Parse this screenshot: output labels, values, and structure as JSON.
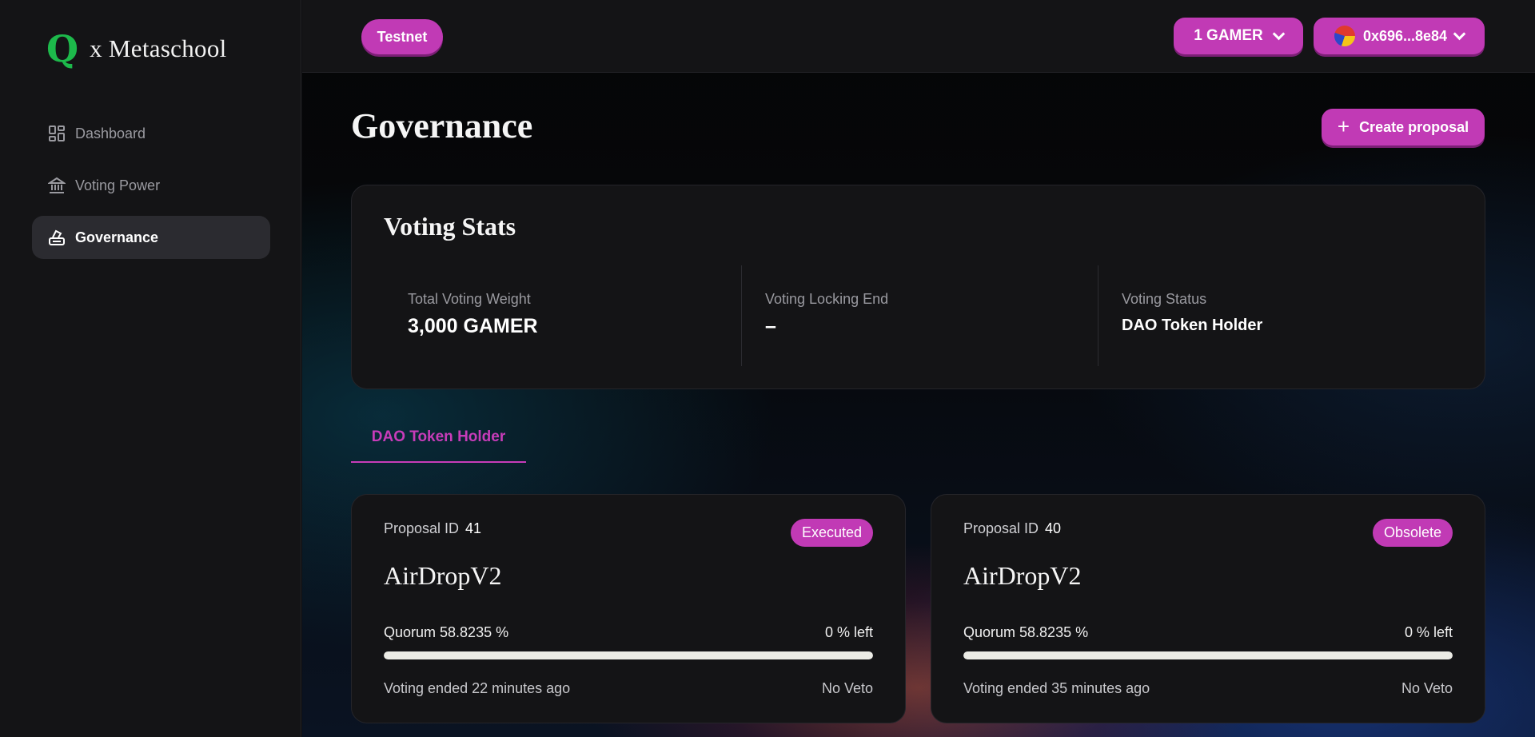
{
  "brand": {
    "logo_letter": "Q",
    "name": "x Metaschool",
    "logo_color": "#1db94b"
  },
  "sidebar": {
    "items": [
      {
        "label": "Dashboard",
        "icon": "dashboard-icon",
        "active": false
      },
      {
        "label": "Voting Power",
        "icon": "bank-icon",
        "active": false
      },
      {
        "label": "Governance",
        "icon": "governance-icon",
        "active": true
      }
    ]
  },
  "topbar": {
    "network": "Testnet",
    "balance": "1 GAMER",
    "wallet_address": "0x696...8e84"
  },
  "page": {
    "title": "Governance",
    "create_button": "Create proposal"
  },
  "voting_stats": {
    "title": "Voting Stats",
    "total_weight_label": "Total Voting Weight",
    "total_weight_value": "3,000 GAMER",
    "locking_end_label": "Voting Locking End",
    "locking_end_value": "–",
    "status_label": "Voting Status",
    "status_value": "DAO Token Holder"
  },
  "tabs": [
    {
      "label": "DAO Token Holder",
      "active": true
    }
  ],
  "proposals": [
    {
      "id_label": "Proposal ID",
      "id": "41",
      "status": "Executed",
      "name": "AirDropV2",
      "quorum": "Quorum 58.8235 %",
      "left": "0 % left",
      "progress": 1.0,
      "ended": "Voting ended 22 minutes ago",
      "veto": "No Veto"
    },
    {
      "id_label": "Proposal ID",
      "id": "40",
      "status": "Obsolete",
      "name": "AirDropV2",
      "quorum": "Quorum 58.8235 %",
      "left": "0 % left",
      "progress": 1.0,
      "ended": "Voting ended 35 minutes ago",
      "veto": "No Veto"
    }
  ],
  "colors": {
    "accent": "#c13ab5",
    "background": "#0d0d0f",
    "card": "#141416"
  }
}
